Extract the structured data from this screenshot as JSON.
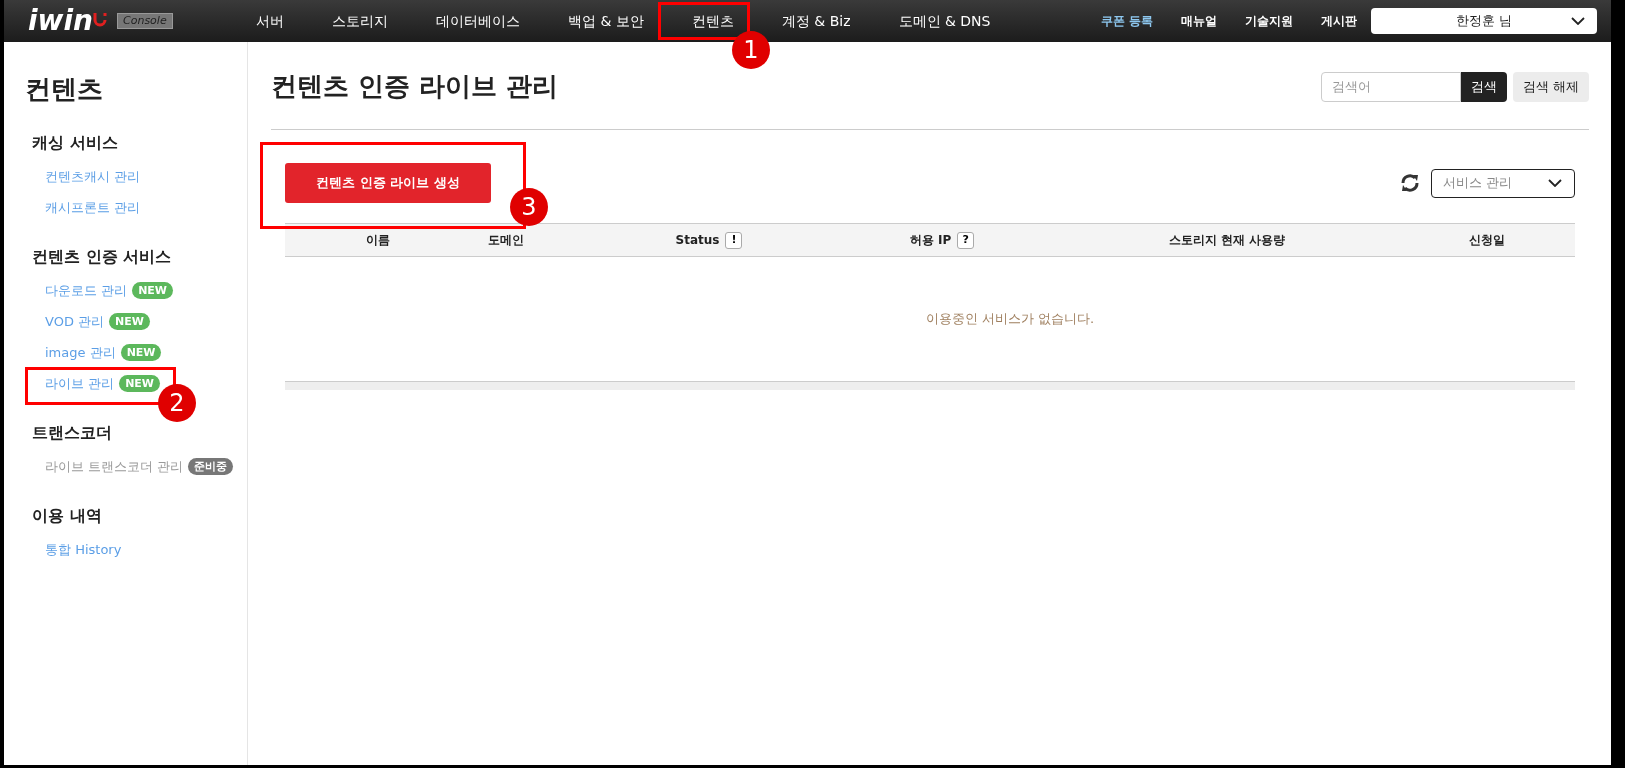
{
  "header": {
    "logo": "iwin",
    "console_badge": "Console",
    "nav": [
      {
        "label": "서버"
      },
      {
        "label": "스토리지"
      },
      {
        "label": "데이터베이스"
      },
      {
        "label": "백업 & 보안"
      },
      {
        "label": "컨텐츠"
      },
      {
        "label": "계정 & Biz"
      },
      {
        "label": "도메인 & DNS"
      }
    ],
    "links": [
      {
        "label": "쿠폰 등록",
        "highlighted": true
      },
      {
        "label": "매뉴얼",
        "highlighted": false
      },
      {
        "label": "기술지원",
        "highlighted": false
      },
      {
        "label": "게시판",
        "highlighted": false
      }
    ],
    "user": "한정훈 님"
  },
  "sidebar": {
    "title": "컨텐츠",
    "sections": [
      {
        "heading": "캐싱 서비스",
        "items": [
          {
            "label": "컨텐츠캐시 관리",
            "disabled": false
          },
          {
            "label": "캐시프론트 관리",
            "disabled": false
          }
        ]
      },
      {
        "heading": "컨텐츠 인증 서비스",
        "items": [
          {
            "label": "다운로드 관리",
            "disabled": false,
            "badge": {
              "text": "NEW",
              "kind": "new"
            }
          },
          {
            "label": "VOD 관리",
            "disabled": false,
            "badge": {
              "text": "NEW",
              "kind": "new"
            }
          },
          {
            "label": "image 관리",
            "disabled": false,
            "badge": {
              "text": "NEW",
              "kind": "new"
            }
          },
          {
            "label": "라이브 관리",
            "disabled": false,
            "badge": {
              "text": "NEW",
              "kind": "new"
            }
          }
        ]
      },
      {
        "heading": "트랜스코더",
        "items": [
          {
            "label": "라이브 트랜스코더 관리",
            "disabled": true,
            "badge": {
              "text": "준비중",
              "kind": "pending"
            }
          }
        ]
      },
      {
        "heading": "이용 내역",
        "items": [
          {
            "label": "통합 History",
            "disabled": false
          }
        ]
      }
    ]
  },
  "main": {
    "title": "컨텐츠 인증 라이브 관리",
    "search": {
      "placeholder": "검색어",
      "button": "검색",
      "clear": "검색 해제"
    },
    "create_button": "컨텐츠 인증 라이브 생성",
    "service_select": "서비스 관리",
    "table": {
      "columns": [
        {
          "label": "이름"
        },
        {
          "label": "도메인"
        },
        {
          "label": "Status",
          "help": "!"
        },
        {
          "label": "허용 IP",
          "help": "?"
        },
        {
          "label": "스토리지 현재 사용량"
        },
        {
          "label": "신청일"
        }
      ],
      "empty_message": "이용중인 서비스가 없습니다."
    }
  },
  "annotations": [
    {
      "number": "1"
    },
    {
      "number": "2"
    },
    {
      "number": "3"
    }
  ]
}
